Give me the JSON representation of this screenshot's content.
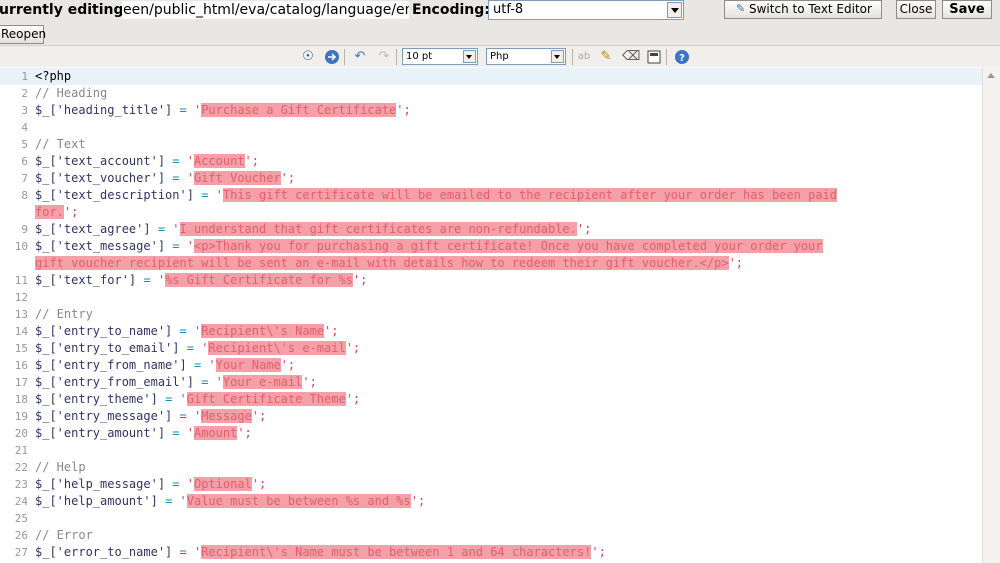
{
  "header": {
    "editing_label": "urrently editing:",
    "path_value": "een/public_html/eva/catalog/language/engli",
    "encoding_label": "Encoding:",
    "encoding_value": "utf-8",
    "switch_label": "Switch to Text Editor",
    "close_label": "Close",
    "save_label": "Save",
    "reopen_label": "Reopen"
  },
  "toolbar": {
    "font_size": "10 pt",
    "syntax": "Php",
    "icons": [
      "search-icon",
      "goto-icon",
      "undo-icon",
      "redo-icon",
      "spellcheck-icon",
      "highlight-icon",
      "eraser-icon",
      "fullscreen-icon",
      "help-icon"
    ]
  },
  "editor": {
    "lines": [
      {
        "n": "1",
        "text": "<?php"
      },
      {
        "n": "2",
        "text": "// Heading"
      },
      {
        "n": "3",
        "key": "$_['heading_title']",
        "pad": "    ",
        "val": "Purchase a Gift Certificate"
      },
      {
        "n": "4",
        "text": ""
      },
      {
        "n": "5",
        "text": "// Text"
      },
      {
        "n": "6",
        "key": "$_['text_account']",
        "pad": "     ",
        "val": "Account"
      },
      {
        "n": "7",
        "key": "$_['text_voucher']",
        "pad": "     ",
        "val": "Gift Voucher"
      },
      {
        "n": "8",
        "key": "$_['text_description']",
        "pad": " ",
        "val": "This gift certificate will be emailed to the recipient after your order has been paid "
      },
      {
        "n": "",
        "cont": "for.",
        "tail": "';"
      },
      {
        "n": "9",
        "key": "$_['text_agree']",
        "pad": "       ",
        "val": "I understand that gift certificates are non-refundable."
      },
      {
        "n": "10",
        "key": "$_['text_message']",
        "pad": "     ",
        "val": "<p>Thank you for purchasing a gift certificate! Once you have completed your order your"
      },
      {
        "n": "",
        "cont": "gift voucher recipient will be sent an e-mail with details how to redeem their gift voucher.</p>",
        "tail": "';"
      },
      {
        "n": "11",
        "key": "$_['text_for']",
        "pad": "         ",
        "val": "%s Gift Certificate for %s"
      },
      {
        "n": "12",
        "text": ""
      },
      {
        "n": "13",
        "text": "// Entry"
      },
      {
        "n": "14",
        "key": "$_['entry_to_name']",
        "pad": "    ",
        "val": "Recipient\\'s Name"
      },
      {
        "n": "15",
        "key": "$_['entry_to_email']",
        "pad": "   ",
        "val": "Recipient\\'s e-mail"
      },
      {
        "n": "16",
        "key": "$_['entry_from_name']",
        "pad": "  ",
        "val": "Your Name"
      },
      {
        "n": "17",
        "key": "$_['entry_from_email']",
        "pad": " ",
        "val": "Your e-mail"
      },
      {
        "n": "18",
        "key": "$_['entry_theme']",
        "pad": "      ",
        "val": "Gift Certificate Theme"
      },
      {
        "n": "19",
        "key": "$_['entry_message']",
        "pad": "    ",
        "val": "Message"
      },
      {
        "n": "20",
        "key": "$_['entry_amount']",
        "pad": "     ",
        "val": "Amount"
      },
      {
        "n": "21",
        "text": ""
      },
      {
        "n": "22",
        "text": "// Help"
      },
      {
        "n": "23",
        "key": "$_['help_message']",
        "pad": "     ",
        "val": "Optional"
      },
      {
        "n": "24",
        "key": "$_['help_amount']",
        "pad": "      ",
        "val": "Value must be between %s and %s"
      },
      {
        "n": "25",
        "text": ""
      },
      {
        "n": "26",
        "text": "// Error"
      },
      {
        "n": "27",
        "key": "$_['error_to_name']",
        "pad": "    ",
        "val": "Recipient\\'s Name must be between 1 and 64 characters!"
      }
    ]
  }
}
